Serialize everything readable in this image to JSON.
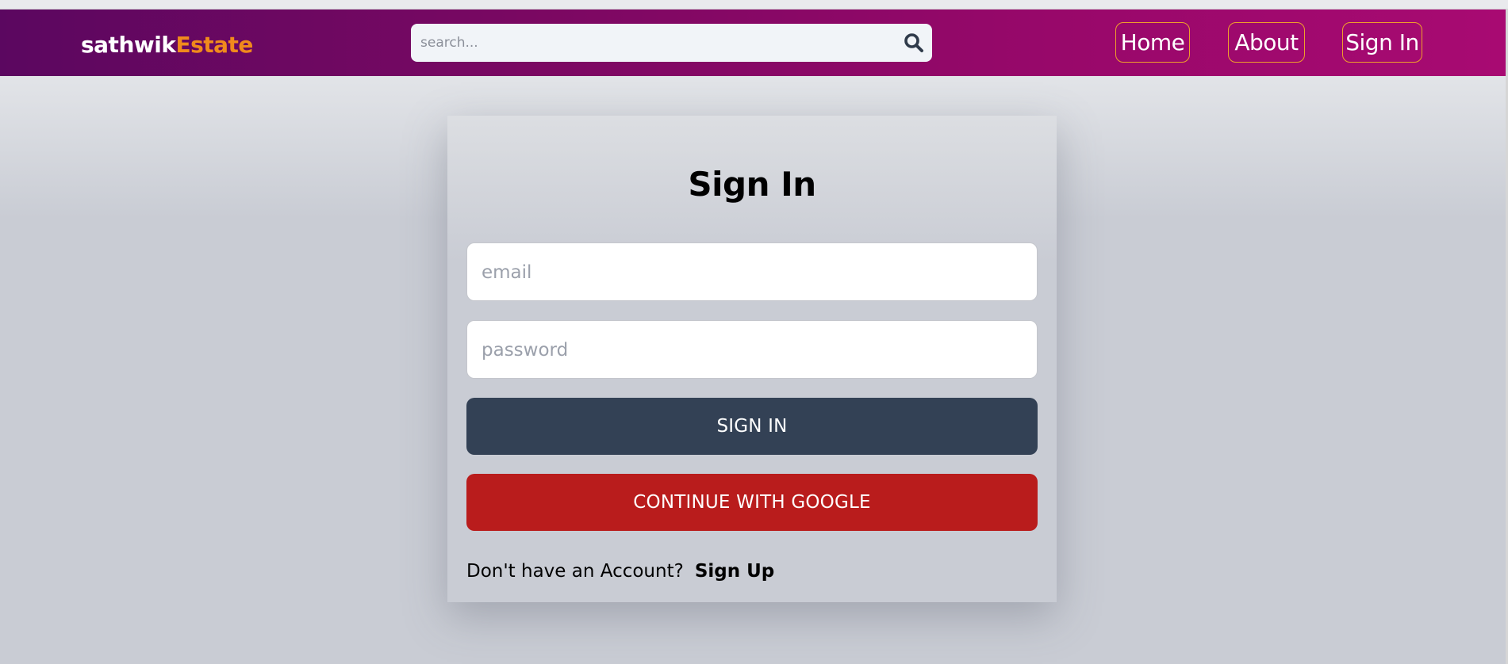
{
  "header": {
    "logo_part1": "sathwik",
    "logo_part2": "Estate",
    "search_placeholder": "search...",
    "nav": {
      "home": "Home",
      "about": "About",
      "sign_in": "Sign In"
    }
  },
  "form": {
    "title": "Sign In",
    "email_placeholder": "email",
    "password_placeholder": "password",
    "sign_in_button": "SIGN IN",
    "google_button": "CONTINUE WITH GOOGLE",
    "no_account_text": "Don't have an Account?",
    "sign_up_link": "Sign Up"
  },
  "icons": {
    "search": "search-icon"
  },
  "colors": {
    "header_gradient_start": "#5b0760",
    "header_gradient_end": "#a80a72",
    "logo_accent": "#f08a1c",
    "nav_border": "#f0a02a",
    "sign_in_button": "#334155",
    "google_button": "#b91c1c",
    "page_background": "#c9ccd4"
  }
}
